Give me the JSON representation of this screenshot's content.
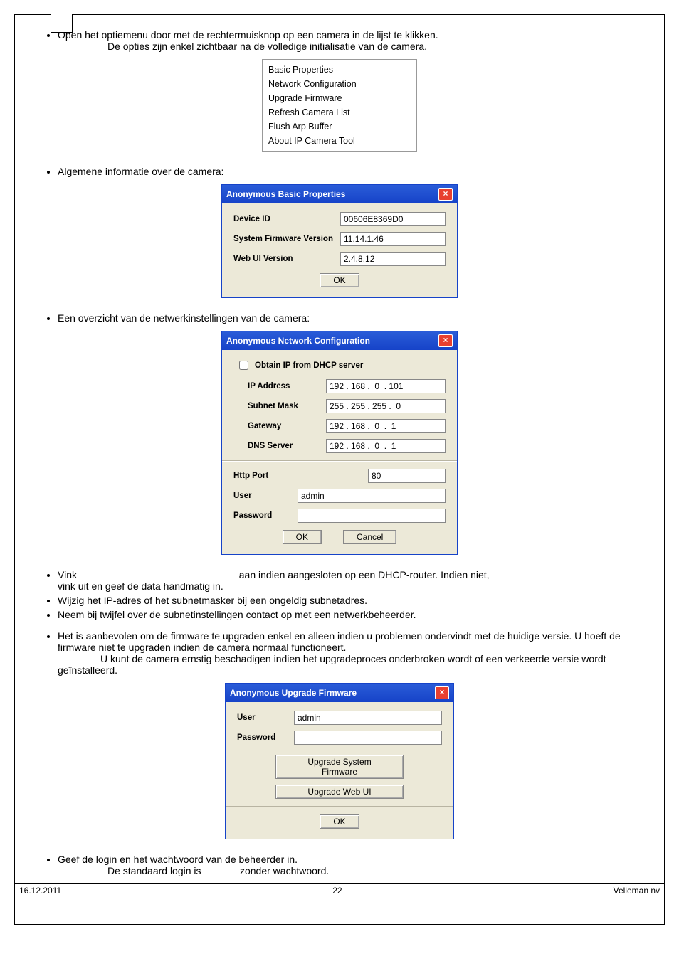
{
  "intro": {
    "line1": "Open het optiemenu door met de rechtermuisknop op een camera in de lijst te klikken.",
    "line2": "De opties zijn enkel zichtbaar na de volledige initialisatie van de camera."
  },
  "context_menu": [
    "Basic Properties",
    "Network Configuration",
    "Upgrade Firmware",
    "Refresh Camera List",
    "Flush Arp Buffer",
    "About IP Camera Tool"
  ],
  "bullet_general": "Algemene informatie over de camera:",
  "basic_props": {
    "title": "Anonymous Basic Properties",
    "device_id_label": "Device ID",
    "device_id_value": "00606E8369D0",
    "fw_label": "System Firmware Version",
    "fw_value": "11.14.1.46",
    "webui_label": "Web UI Version",
    "webui_value": "2.4.8.12",
    "ok": "OK"
  },
  "bullet_network": "Een overzicht van de netwerkinstellingen van de camera:",
  "netcfg": {
    "title": "Anonymous Network Configuration",
    "dhcp_label": "Obtain IP from DHCP server",
    "ip_label": "IP Address",
    "ip_value": "192 . 168 .  0  . 101",
    "mask_label": "Subnet Mask",
    "mask_value": "255 . 255 . 255 .  0",
    "gw_label": "Gateway",
    "gw_value": "192 . 168 .  0  .  1",
    "dns_label": "DNS Server",
    "dns_value": "192 . 168 .  0  .  1",
    "http_label": "Http Port",
    "http_value": "80",
    "user_label": "User",
    "user_value": "admin",
    "pw_label": "Password",
    "pw_value": "",
    "ok": "OK",
    "cancel": "Cancel"
  },
  "bullets2": {
    "vink1": "Vink",
    "vink2": "aan indien aangesloten op een DHCP-router. Indien niet,",
    "vink3": "vink uit en geef de data handmatig in.",
    "wijzig": "Wijzig het IP-adres of het subnetmasker bij een ongeldig subnetadres.",
    "neem": "Neem bij twijfel over de subnetinstellingen contact op met een netwerkbeheerder."
  },
  "bullets3": {
    "fw1": "Het is aanbevolen om de firmware te upgraden enkel en alleen indien u problemen ondervindt met de huidige versie. U hoeft de firmware niet te upgraden indien de camera normaal functioneert.",
    "fw2a": "U kunt de camera ernstig beschadigen indien het upgradeproces onderbroken wordt of een verkeerde versie wordt geïnstalleerd."
  },
  "upgrade": {
    "title": "Anonymous Upgrade Firmware",
    "user_label": "User",
    "user_value": "admin",
    "pw_label": "Password",
    "pw_value": "",
    "btn_sys": "Upgrade System Firmware",
    "btn_web": "Upgrade Web UI",
    "ok": "OK"
  },
  "bullets4": {
    "login": "Geef de login en het wachtwoord van de beheerder in.",
    "std": "De standaard login is              zonder wachtwoord."
  },
  "footer": {
    "date": "16.12.2011",
    "page": "22",
    "brand": "Velleman nv"
  }
}
